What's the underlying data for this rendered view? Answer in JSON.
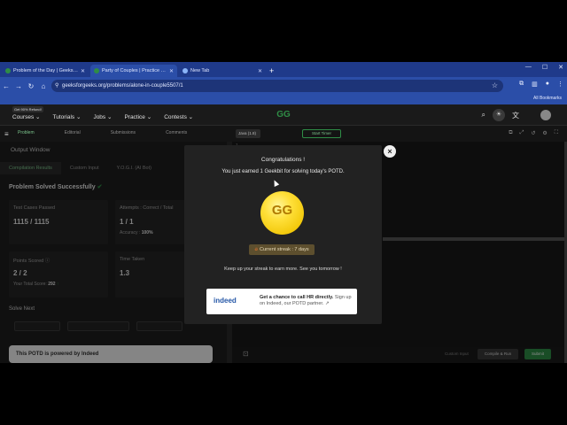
{
  "browser": {
    "tabs": [
      {
        "label": "Problem of the Day | GeeksforG..."
      },
      {
        "label": "Party of Couples | Practice | Ge..."
      },
      {
        "label": "New Tab"
      }
    ],
    "url": "geeksforgeeks.org/problems/alone-in-couple5507/1",
    "bookmarks_label": "All Bookmarks"
  },
  "site": {
    "promo": "Get 90% Refund!",
    "nav": [
      "Courses",
      "Tutorials",
      "Jobs",
      "Practice",
      "Contests"
    ],
    "logo": "GG"
  },
  "problem_toolbar": {
    "tabs": [
      "Problem",
      "Editorial",
      "Submissions",
      "Comments"
    ],
    "language": "Java (1.8)",
    "timer": "Start Timer"
  },
  "output_window": {
    "title": "Output Window",
    "tabs": [
      "Compilation Results",
      "Custom Input",
      "Y.O.G.I. (AI Bot)"
    ],
    "status": "Problem Solved Successfully",
    "cards": {
      "tests": {
        "title": "Test Cases Passed",
        "value": "1115 / 1115"
      },
      "attempts": {
        "title": "Attempts : Correct / Total",
        "value": "1 / 1",
        "sub_label": "Accuracy :",
        "sub_value": "100%"
      },
      "points": {
        "title": "Points Scored",
        "value": "2 / 2",
        "sub_label": "Your Total Score:",
        "sub_value": "292"
      },
      "time": {
        "title": "Time Taken",
        "value": "1.3"
      }
    },
    "solve_next": "Solve Next",
    "indeed_title": "This POTD is powered by Indeed"
  },
  "editor": {
    "line": "1",
    "custom_input": "Custom Input",
    "compile": "Compile & Run",
    "submit": "Submit"
  },
  "modal": {
    "congrats": "Congratulations !",
    "earned": "You just earned 1 Geekbit for solving today's POTD.",
    "coin_text": "GG",
    "streak": "Current streak : 7 days",
    "keep_up": "Keep up your streak to earn more. See you tomorrow !",
    "ad_logo": "indeed",
    "ad_bold": "Get a chance to call HR directly.",
    "ad_rest": "Sign up on Indeed, our POTD partner.",
    "close": "×"
  }
}
